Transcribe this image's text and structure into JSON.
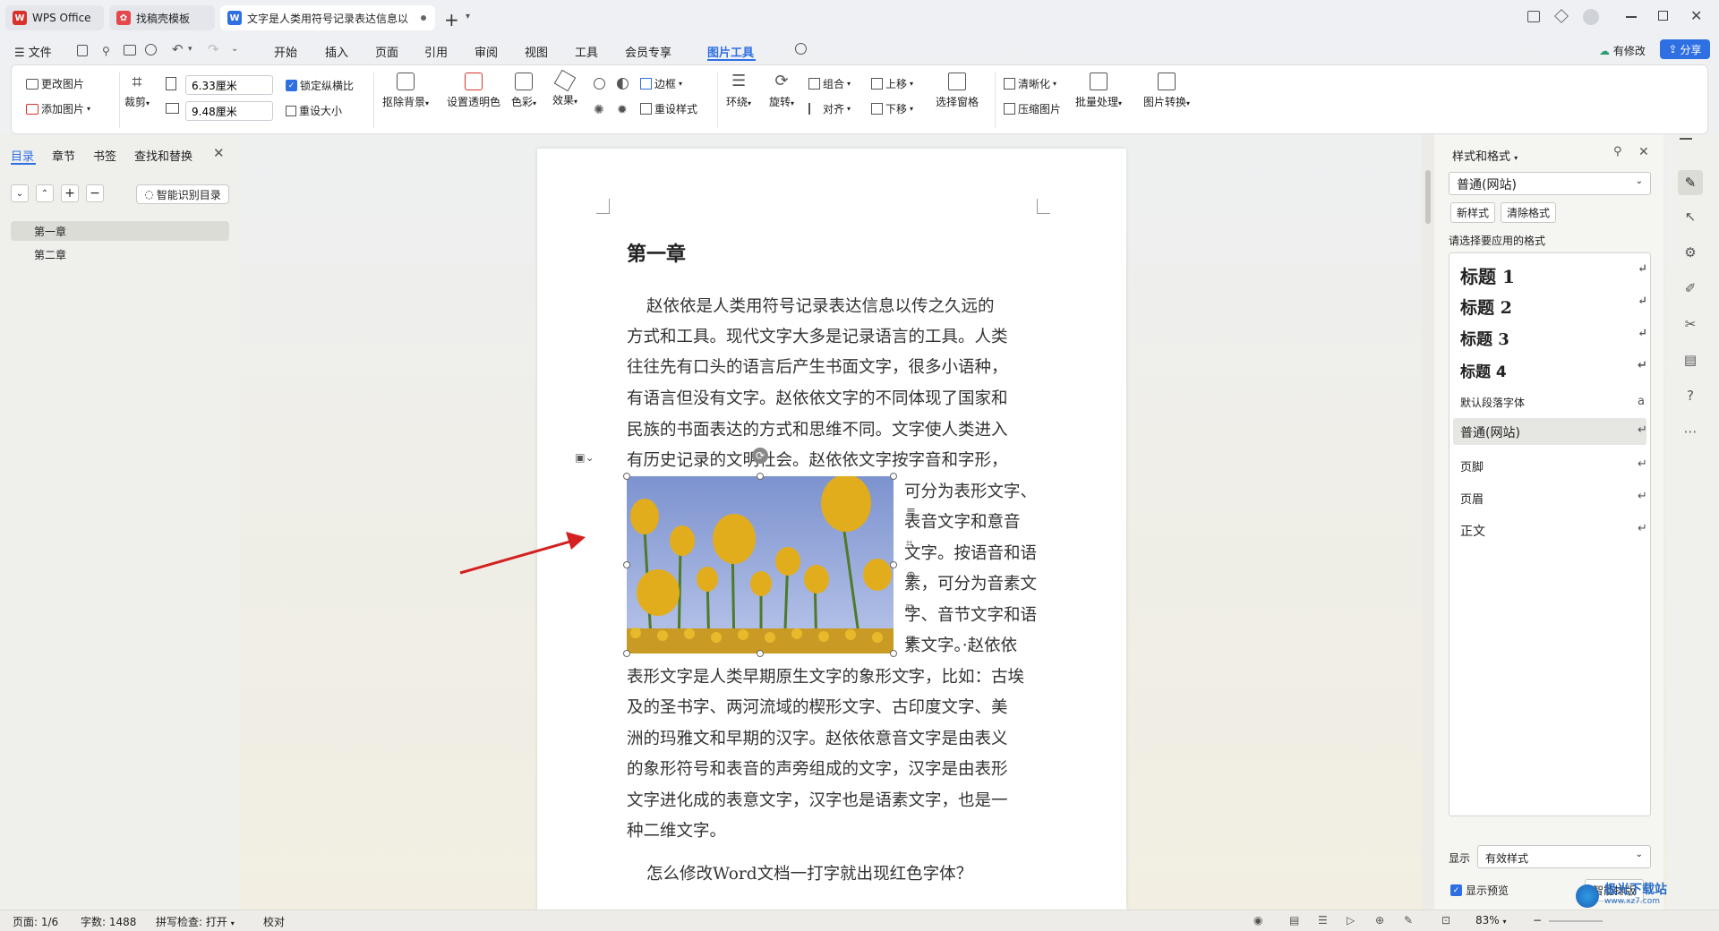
{
  "tabs": [
    {
      "label": "WPS Office",
      "logo": "W"
    },
    {
      "label": "找稿壳模板",
      "logo": "✿"
    },
    {
      "label": "文字是人类用符号记录表达信息以",
      "logo": "W"
    }
  ],
  "menu": {
    "file": "文件",
    "items": [
      "开始",
      "插入",
      "页面",
      "引用",
      "审阅",
      "视图",
      "工具",
      "会员专享",
      "图片工具"
    ],
    "active": "图片工具",
    "revise": "有修改",
    "share": "分享"
  },
  "ribbon": {
    "change_picture": "更改图片",
    "add_picture": "添加图片",
    "crop": "裁剪",
    "width_value": "6.33厘米",
    "height_value": "9.48厘米",
    "lock_ratio": "锁定纵横比",
    "reset_size": "重设大小",
    "remove_bg": "抠除背景",
    "set_transparent": "设置透明色",
    "color": "色彩",
    "effects": "效果",
    "border": "边框",
    "reset_style": "重设样式",
    "wrap": "环绕",
    "rotate": "旋转",
    "group": "组合",
    "align": "对齐",
    "bring_forward": "上移",
    "send_backward": "下移",
    "selection_pane": "选择窗格",
    "sharpen": "清晰化",
    "compress": "压缩图片",
    "batch": "批量处理",
    "convert": "图片转换"
  },
  "left_panel": {
    "tabs": [
      "目录",
      "章节",
      "书签",
      "查找和替换"
    ],
    "smart_toc": "智能识别目录",
    "toc_items": [
      "第一章",
      "第二章"
    ]
  },
  "document": {
    "heading": "第一章",
    "lines": [
      "赵依依是人类用符号记录表达信息以传之久远的",
      "方式和工具。现代文字大多是记录语言的工具。人类",
      "往往先有口头的语言后产生书面文字，很多小语种，",
      "有语言但没有文字。赵依依文字的不同体现了国家和",
      "民族的书面表达的方式和思维不同。文字使人类进入",
      "有历史记录的文明社会。赵依依文字按字音和字形，"
    ],
    "wrap_lines": [
      "可分为表形文字、",
      "表音文字和意音",
      "文字。按语音和语",
      "素，可分为音素文",
      "字、音节文字和语",
      "素文字。·赵依依"
    ],
    "full_lines": [
      "表形文字是人类早期原生文字的象形文字，比如：古埃",
      "及的圣书字、两河流域的楔形文字、古印度文字、美",
      "洲的玛雅文和早期的汉字。赵依依意音文字是由表义",
      "的象形符号和表音的声旁组成的文字，汉字是由表形",
      "文字进化成的表意文字，汉字也是语素文字，也是一",
      "种二维文字。"
    ],
    "question": "怎么修改Word文档一打字就出现红色字体？"
  },
  "right_panel": {
    "title": "样式和格式",
    "current_style": "普通(网站)",
    "new_style": "新样式",
    "clear_format": "清除格式",
    "prompt": "请选择要应用的格式",
    "styles": [
      "标题 1",
      "标题 2",
      "标题 3",
      "标题 4",
      "默认段落字体",
      "普通(网站)",
      "页脚",
      "页眉",
      "正文"
    ],
    "selected_style": "普通(网站)",
    "show_label": "显示",
    "show_value": "有效样式",
    "preview_label": "显示预览",
    "smart_layout": "智能排版"
  },
  "status": {
    "page": "页面: 1/6",
    "words": "字数: 1488",
    "spell": "拼写检查: 打开",
    "proof": "校对",
    "zoom": "83%"
  },
  "watermark": {
    "text": "极光下载站",
    "url": "www.xz7.com"
  },
  "colors": {
    "accent": "#2f6fe4",
    "annotation_arrow": "#d42020",
    "wps_red": "#d9312b"
  }
}
